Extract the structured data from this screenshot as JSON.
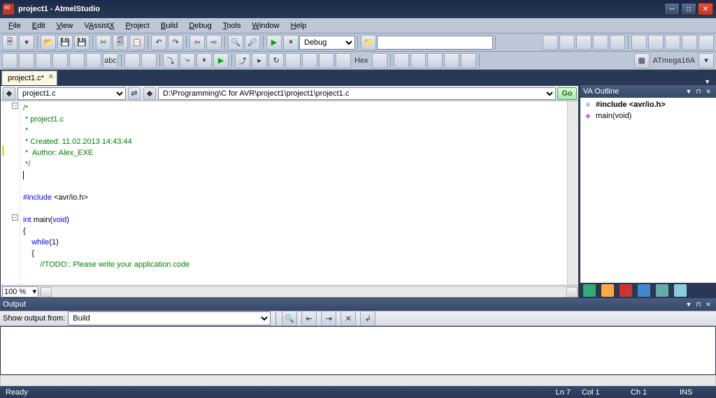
{
  "window": {
    "title": "project1 - AtmelStudio"
  },
  "menu": [
    "File",
    "Edit",
    "View",
    "VAssistX",
    "Project",
    "Build",
    "Debug",
    "Tools",
    "Window",
    "Help"
  ],
  "toolbar2": {
    "debug_config": "Debug",
    "device": "ATmega16A",
    "hex_label": "Hex"
  },
  "tabs": {
    "active": "project1.c*"
  },
  "nav": {
    "left": "project1.c",
    "path": "D:\\Programming\\C for AVR\\project1\\project1\\project1.c",
    "go": "Go"
  },
  "code": {
    "l1": "/*",
    "l2": " * project1.c",
    "l3": " *",
    "l4": " * Created: 11.02.2013 14:43:44",
    "l5": " *  Author: Alex_EXE",
    "l6": " */",
    "l7": "",
    "l8": "",
    "l9a": "#include ",
    "l9b": "<avr/io.h>",
    "l10": "",
    "l11a": "int ",
    "l11b": "main",
    "l11c": "(",
    "l11d": "void",
    "l11e": ")",
    "l12": "{",
    "l13a": "    ",
    "l13b": "while",
    "l13c": "(1)",
    "l14": "    {",
    "l15a": "        ",
    "l15b": "//TODO:: Please write your application code"
  },
  "zoom": "100 %",
  "vaoutline": {
    "title": "VA Outline",
    "items": [
      {
        "icon": "≡",
        "label": "#include <avr/io.h>",
        "sel": true
      },
      {
        "icon": "◈",
        "label": "main(void)",
        "sel": false
      }
    ]
  },
  "output": {
    "title": "Output",
    "show_label": "Show output from:",
    "source": "Build"
  },
  "status": {
    "ready": "Ready",
    "ln": "Ln 7",
    "col": "Col 1",
    "ch": "Ch 1",
    "ins": "INS"
  }
}
